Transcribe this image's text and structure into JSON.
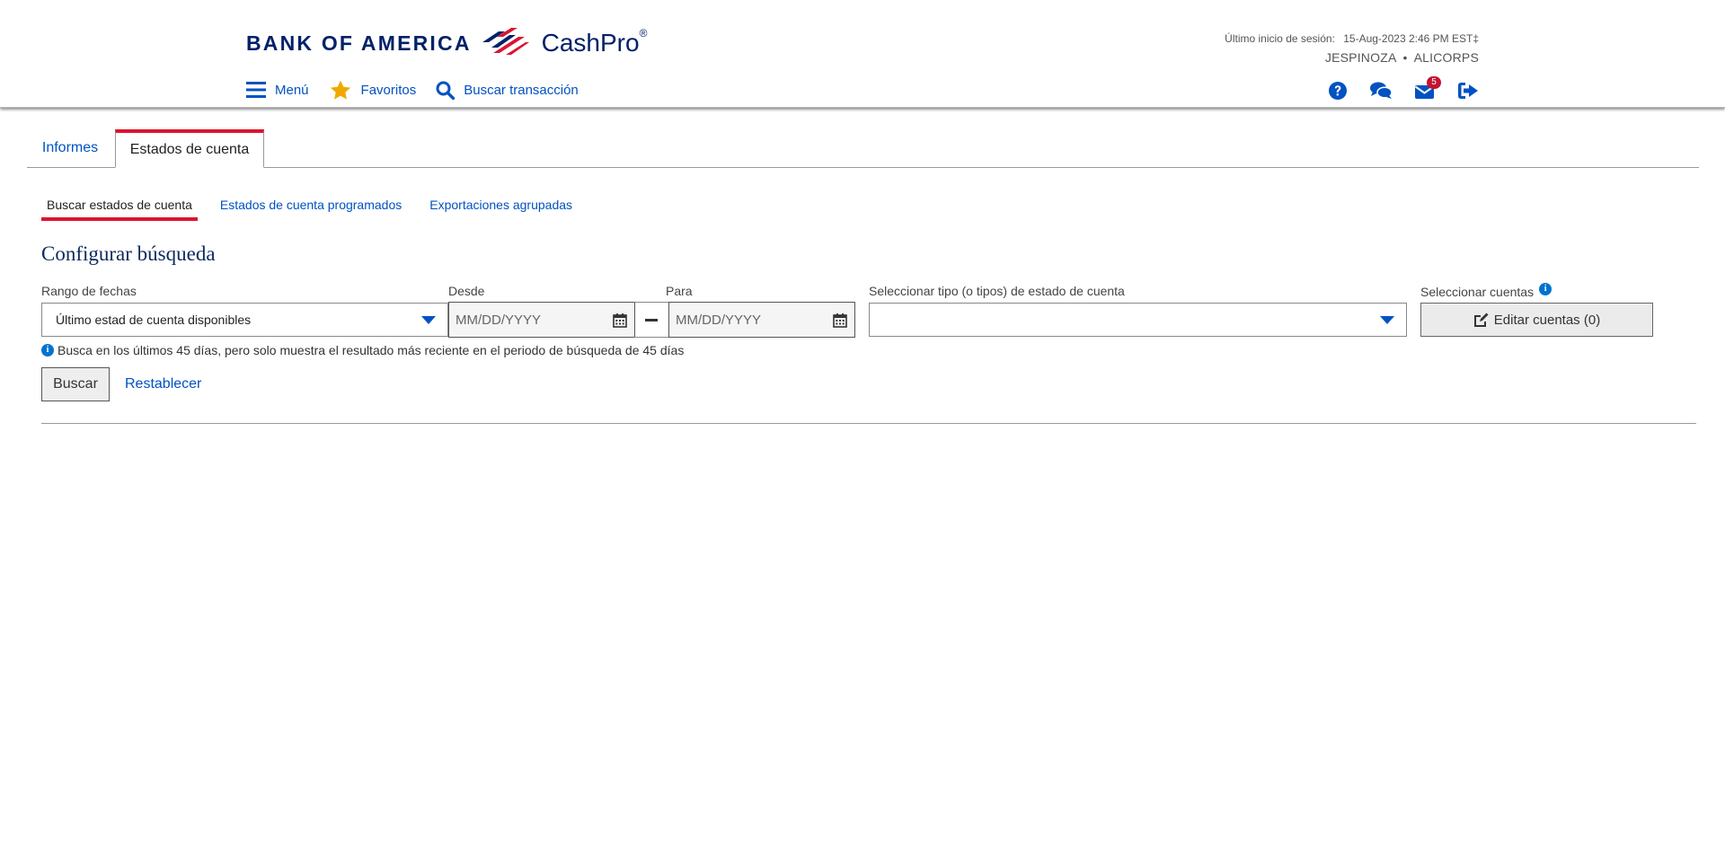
{
  "header": {
    "brand_name": "BANK OF AMERICA",
    "product_name": "CashPro",
    "product_mark": "®",
    "last_login_label": "Último inicio de sesión:",
    "last_login_value": "15-Aug-2023 2:46 PM EST‡",
    "username": "JESPINOZA",
    "separator": "•",
    "company": "ALICORPS",
    "nav": {
      "menu": "Menú",
      "favorites": "Favoritos",
      "search_transaction": "Buscar transacción"
    },
    "icons": {
      "help": "question-circle-icon",
      "chat": "chat-bubbles-icon",
      "mail": "envelope-icon",
      "logout": "sign-out-icon"
    },
    "mail_badge": "5"
  },
  "tabs": {
    "reports": "Informes",
    "statements": "Estados de cuenta"
  },
  "subtabs": {
    "search": "Buscar estados de cuenta",
    "scheduled": "Estados de cuenta programados",
    "bulk_exports": "Exportaciones agrupadas"
  },
  "form": {
    "title": "Configurar búsqueda",
    "date_range_label": "Rango de fechas",
    "date_range_value": "Último estad de cuenta disponibles",
    "from_label": "Desde",
    "from_value": "MM/DD/YYYY",
    "to_label": "Para",
    "to_value": "MM/DD/YYYY",
    "statement_type_label": "Seleccionar tipo (o tipos) de estado de cuenta",
    "statement_type_value": "",
    "accounts_label": "Seleccionar cuentas",
    "edit_accounts_button": "Editar cuentas (0)",
    "info_text": "Busca en los últimos 45 días, pero solo muestra el resultado más reciente en el periodo de búsqueda de 45 días",
    "search_button": "Buscar",
    "reset_link": "Restablecer"
  },
  "colors": {
    "brand_navy": "#012169",
    "brand_red": "#dc1431",
    "link_blue": "#0052c2",
    "favorites_star": "#f0a800",
    "badge_red": "#c41230"
  }
}
